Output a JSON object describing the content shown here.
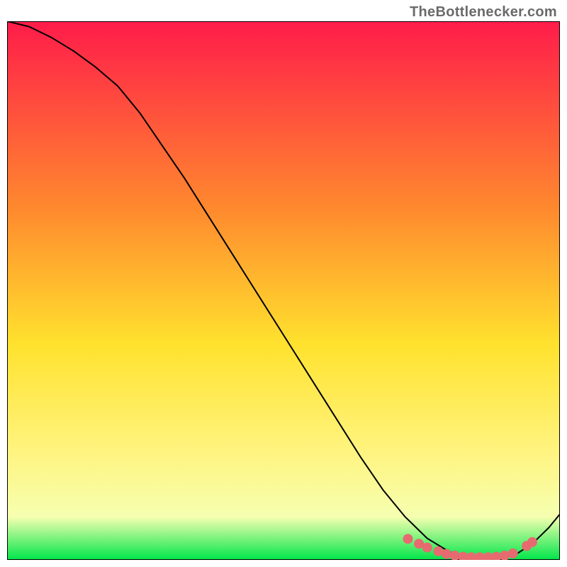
{
  "watermark": "TheBottlenecker.com",
  "chart_data": {
    "type": "line",
    "title": "",
    "xlabel": "",
    "ylabel": "",
    "xlim": [
      0,
      100
    ],
    "ylim": [
      0,
      100
    ],
    "background_gradient": {
      "top": "#ff1c4a",
      "mid_upper": "#ff8a2e",
      "mid": "#ffe22e",
      "mid_lower": "#fff480",
      "low": "#f6ffb0",
      "bottom": "#00e64a"
    },
    "series": [
      {
        "name": "bottleneck-curve",
        "x": [
          0,
          4,
          8,
          12,
          16,
          20,
          24,
          28,
          32,
          36,
          40,
          44,
          48,
          52,
          56,
          60,
          64,
          68,
          72,
          76,
          80,
          83,
          86,
          89,
          92,
          95,
          98,
          100
        ],
        "y": [
          100,
          99,
          97,
          94.5,
          91.5,
          88,
          83,
          77,
          71,
          64.5,
          58,
          51.5,
          45,
          38.5,
          32,
          25.5,
          19,
          13,
          8,
          4,
          1.5,
          0.5,
          0.2,
          0.3,
          1.0,
          3.0,
          6.0,
          8.5
        ]
      }
    ],
    "marker_cluster": {
      "name": "highlight-points",
      "color": "#e76a70",
      "radius": 7,
      "x": [
        72.5,
        74.5,
        76.0,
        78.0,
        79.5,
        81.0,
        82.5,
        84.0,
        85.5,
        87.0,
        88.5,
        90.0,
        91.5,
        94.0,
        95.0
      ],
      "y": [
        3.9,
        3.0,
        2.3,
        1.6,
        1.1,
        0.8,
        0.6,
        0.5,
        0.5,
        0.5,
        0.6,
        0.8,
        1.2,
        2.6,
        3.3
      ]
    },
    "axes_visible": false,
    "grid": false
  }
}
